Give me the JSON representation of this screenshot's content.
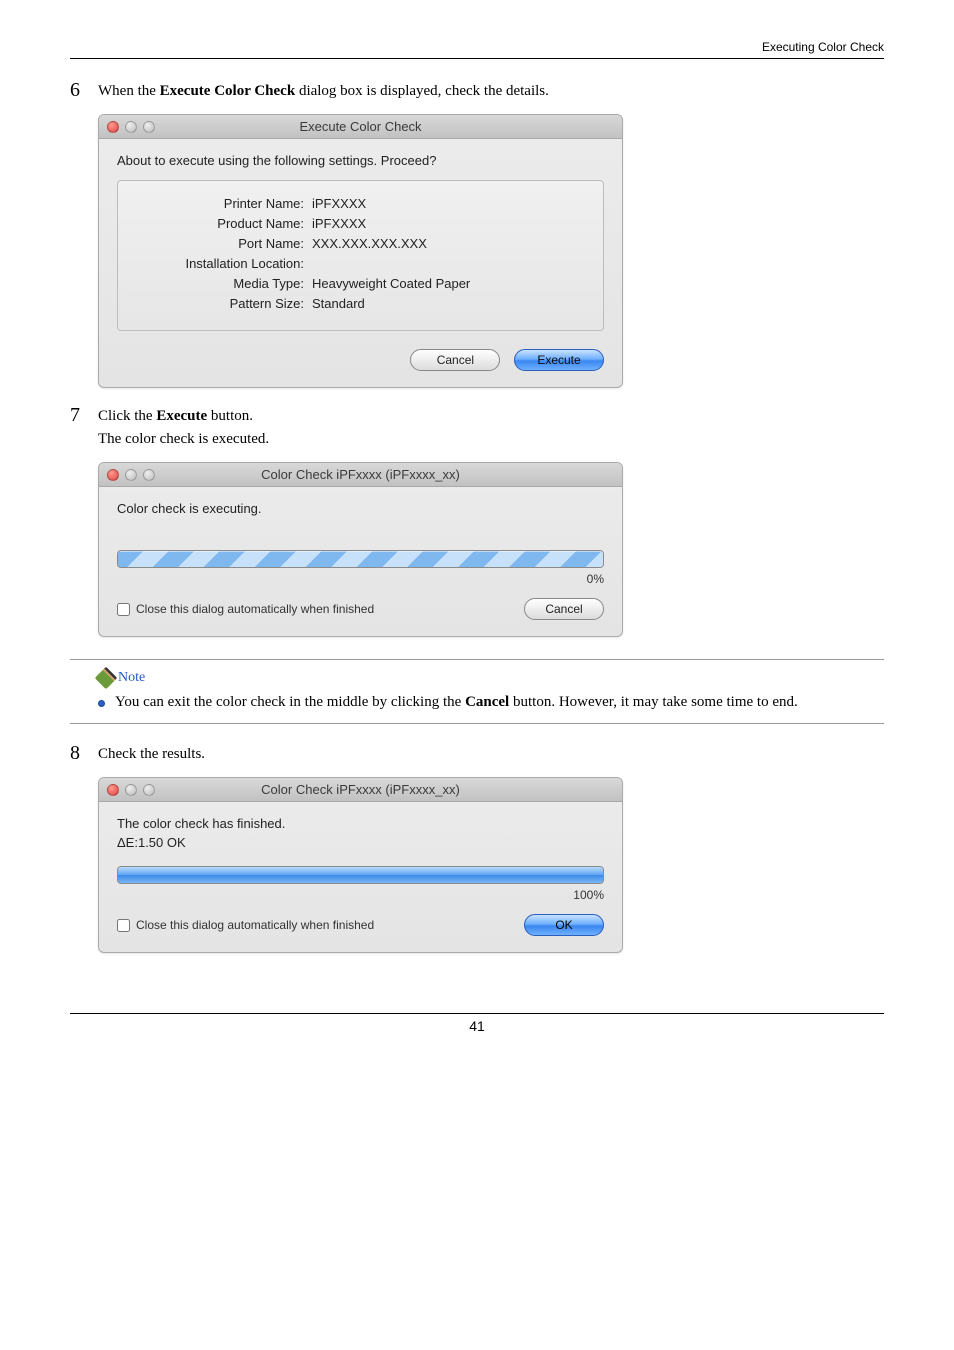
{
  "header": {
    "section_title": "Executing Color Check"
  },
  "step6": {
    "num": "6",
    "text_pre": "When the ",
    "text_bold": "Execute Color Check",
    "text_post": " dialog box is displayed, check the details."
  },
  "dlg1": {
    "title": "Execute Color Check",
    "prompt": "About to execute using the following settings. Proceed?",
    "labels": {
      "printer_name": "Printer Name:",
      "product_name": "Product Name:",
      "port_name": "Port Name:",
      "install_loc": "Installation Location:",
      "media_type": "Media Type:",
      "pattern_size": "Pattern Size:"
    },
    "values": {
      "printer_name": "iPFXXXX",
      "product_name": "iPFXXXX",
      "port_name": "XXX.XXX.XXX.XXX",
      "install_loc": "",
      "media_type": "Heavyweight Coated Paper",
      "pattern_size": "Standard"
    },
    "buttons": {
      "cancel": "Cancel",
      "execute": "Execute"
    }
  },
  "step7": {
    "num": "7",
    "line1_pre": "Click the ",
    "line1_bold": "Execute",
    "line1_post": " button.",
    "line2": "The color check is executed."
  },
  "dlg2": {
    "title": "Color Check iPFxxxx (iPFxxxx_xx)",
    "status": "Color check is executing.",
    "percent": "0%",
    "close_label": "Close this dialog automatically when finished",
    "cancel": "Cancel"
  },
  "note": {
    "label": "Note",
    "text_pre": "You can exit the color check in the middle by clicking the ",
    "text_bold": "Cancel",
    "text_post": " button. However, it may take some time to end."
  },
  "step8": {
    "num": "8",
    "text": "Check the results."
  },
  "dlg3": {
    "title": "Color Check iPFxxxx (iPFxxxx_xx)",
    "status": "The color check has finished.",
    "result": "ΔE:1.50 OK",
    "percent": "100%",
    "close_label": "Close this dialog automatically when finished",
    "ok": "OK"
  },
  "footer": {
    "page": "41"
  }
}
